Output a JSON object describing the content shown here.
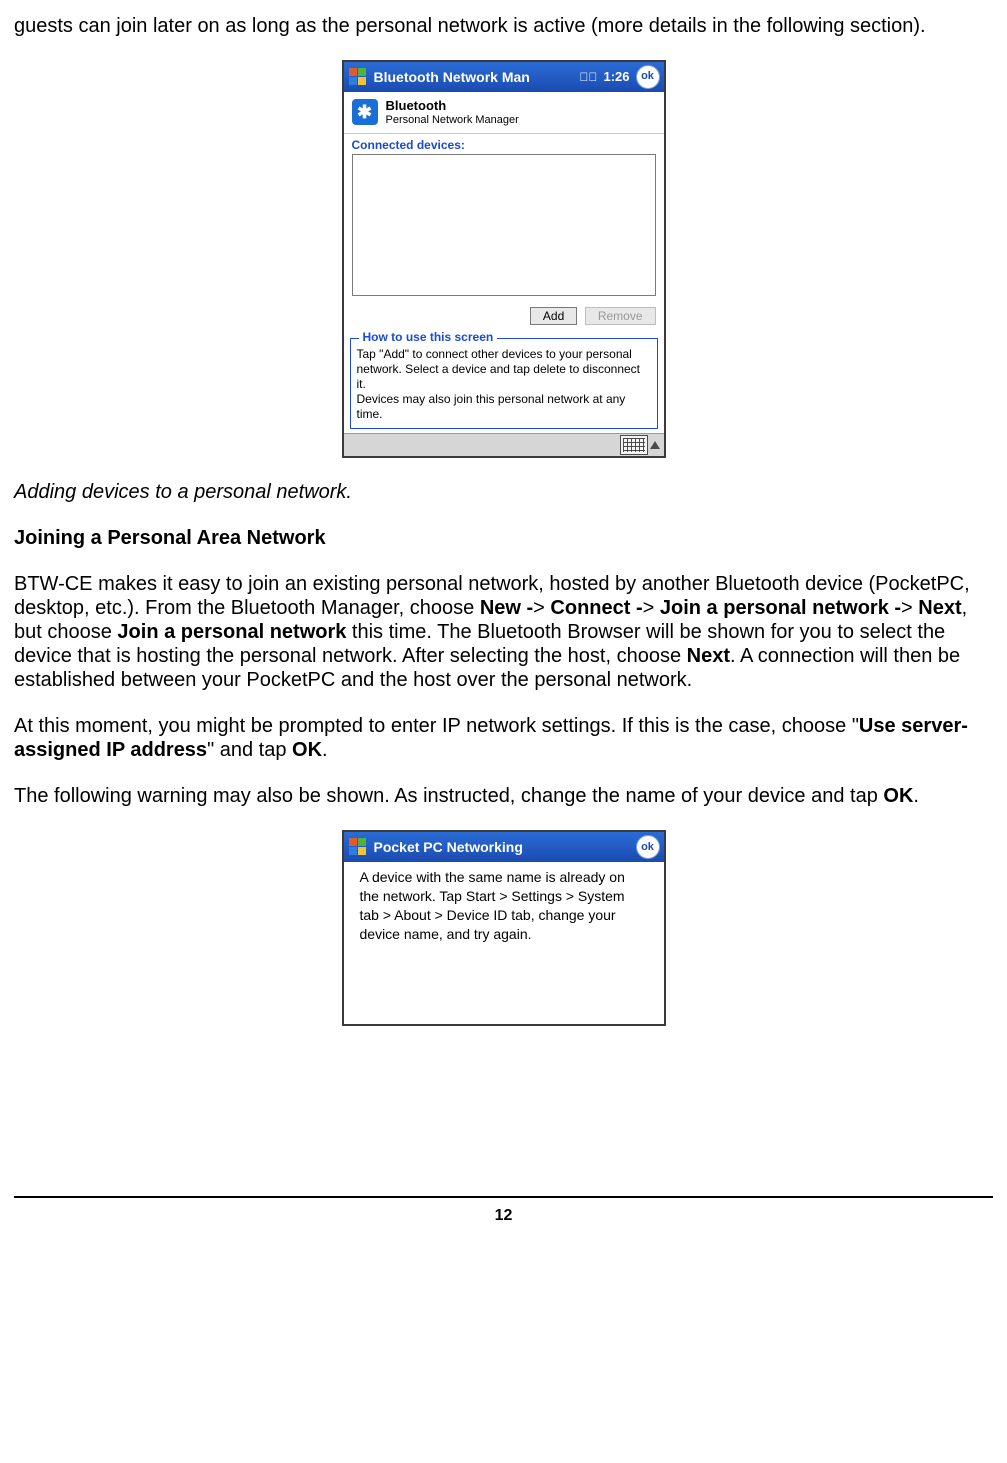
{
  "intro_para": "guests can join later on as long as the personal network is active (more details in the following section).",
  "screenshot1": {
    "titlebar": {
      "title": "Bluetooth Network Man",
      "clock": "1:26",
      "ok": "ok"
    },
    "app_header": {
      "title": "Bluetooth",
      "subtitle": "Personal Network Manager"
    },
    "connected_label": "Connected devices:",
    "buttons": {
      "add": "Add",
      "remove": "Remove"
    },
    "howto": {
      "legend": "How to use this screen",
      "line1": "Tap \"Add\" to connect other devices to your personal network. Select a device and tap delete to disconnect it.",
      "line2": "Devices may also join this personal network at any time."
    }
  },
  "caption1": "Adding devices to a personal network.",
  "section_heading": "Joining a Personal Area Network",
  "para_join": {
    "t1": "BTW-CE makes it easy to join an existing personal network, hosted by another Bluetooth device (PocketPC, desktop, etc.). From the Bluetooth Manager, choose ",
    "b1": "New -",
    "t2": "> ",
    "b2": "Connect -",
    "t3": "> ",
    "b3": "Join a personal network -",
    "t4": "> ",
    "b4": "Next",
    "t5": ", but choose ",
    "b5": "Join a personal network",
    "t6": " this time. The Bluetooth Browser will be shown for you to select the device that is hosting the personal network. After selecting the host, choose ",
    "b6": "Next",
    "t7": ". A connection will then be established between your PocketPC and the host over the personal network."
  },
  "para_ip": {
    "t1": "At this moment, you might be prompted to enter IP network settings. If this is the case, choose \"",
    "b1": "Use server-assigned IP address",
    "t2": "\" and tap ",
    "b2": "OK",
    "t3": "."
  },
  "para_warn": {
    "t1": "The following warning may also be shown. As instructed, change the name of your device and tap ",
    "b1": "OK",
    "t2": "."
  },
  "screenshot2": {
    "titlebar": {
      "title": "Pocket PC Networking",
      "ok": "ok"
    },
    "body": "A device with the same name is already on the network. Tap Start > Settings > System tab > About > Device ID tab, change your device name, and try again."
  },
  "page_number": "12"
}
